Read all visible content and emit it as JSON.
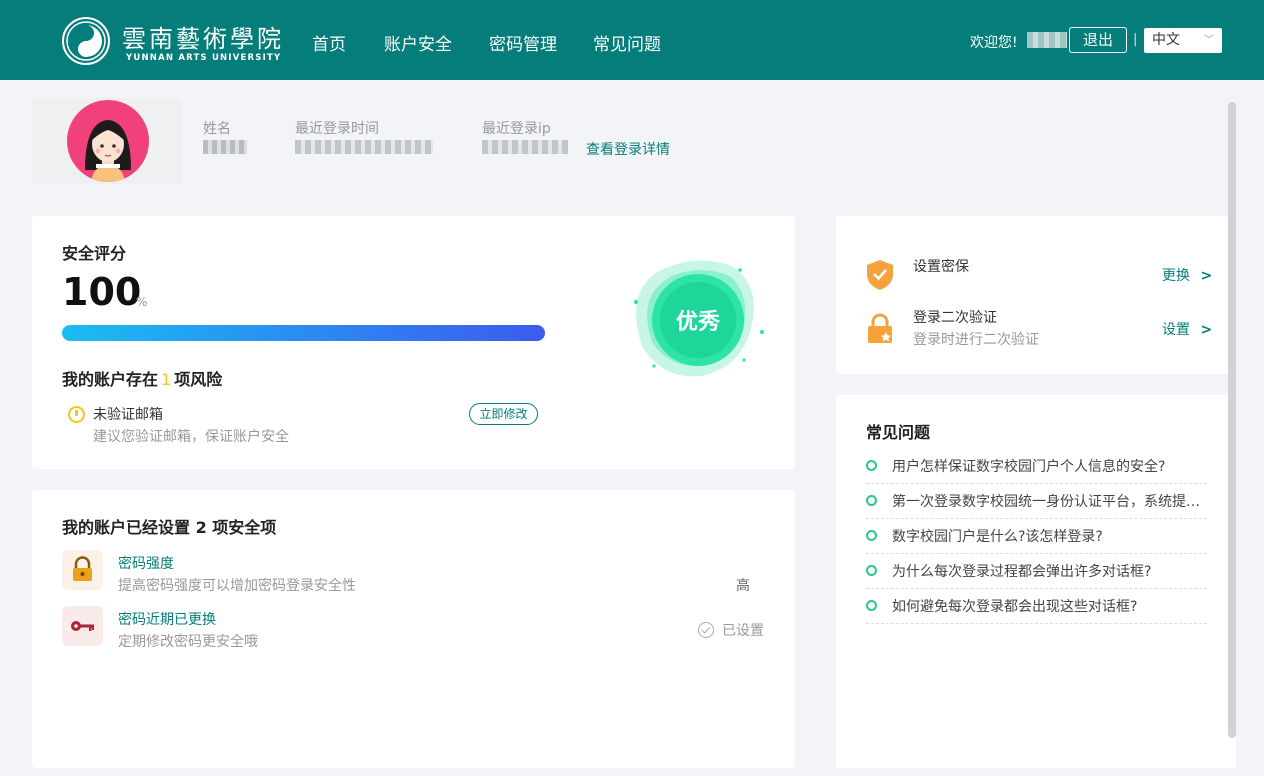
{
  "header": {
    "logo_cn": "雲南藝術學院",
    "logo_en": "YUNNAN ARTS UNIVERSITY",
    "nav": [
      "首页",
      "账户安全",
      "密码管理",
      "常见问题"
    ],
    "welcome": "欢迎您!",
    "logout_label": "退出",
    "separator": "|",
    "language": "中文",
    "language_arrow": "chevron-down-icon"
  },
  "profile": {
    "name_label": "姓名",
    "last_login_time_label": "最近登录时间",
    "last_login_ip_label": "最近登录ip",
    "login_detail_link": "查看登录详情"
  },
  "score": {
    "title": "安全评分",
    "value": "100",
    "unit": "%",
    "progress_fraction": 1.0,
    "risk_prefix": "我的账户存在",
    "risk_count": "1",
    "risk_suffix": "项风险",
    "risks": [
      {
        "name": "未验证邮箱",
        "desc": "建议您验证邮箱，保证账户安全",
        "action": "立即修改",
        "icon": "warning-icon"
      }
    ],
    "badge_text": "优秀"
  },
  "settings": {
    "title": "我的账户已经设置 2 项安全项",
    "items": [
      {
        "name": "密码强度",
        "desc": "提高密码强度可以增加密码登录安全性",
        "status": "高",
        "icon": "lock-icon"
      },
      {
        "name": "密码近期已更换",
        "desc": "定期修改密码更安全哦",
        "status": "已设置",
        "icon": "key-icon"
      }
    ]
  },
  "quick": {
    "items": [
      {
        "name": "设置密保",
        "sub": "",
        "action": "更换",
        "icon": "shield-check-icon"
      },
      {
        "name": "登录二次验证",
        "sub": "登录时进行二次验证",
        "action": "设置",
        "icon": "lock-star-icon"
      }
    ],
    "action_icon": "chevron-right-icon"
  },
  "faq": {
    "title": "常见问题",
    "items": [
      "用户怎样保证数字校园门户个人信息的安全?",
      "第一次登录数字校园统一身份认证平台，系统提示密码过期怎么办?",
      "数字校园门户是什么?该怎样登录?",
      "为什么每次登录过程都会弹出许多对话框?",
      "如何避免每次登录都会出现这些对话框?"
    ]
  },
  "colors": {
    "brand": "#057d7a",
    "warning": "#f5c518",
    "success": "#2fc48a"
  }
}
